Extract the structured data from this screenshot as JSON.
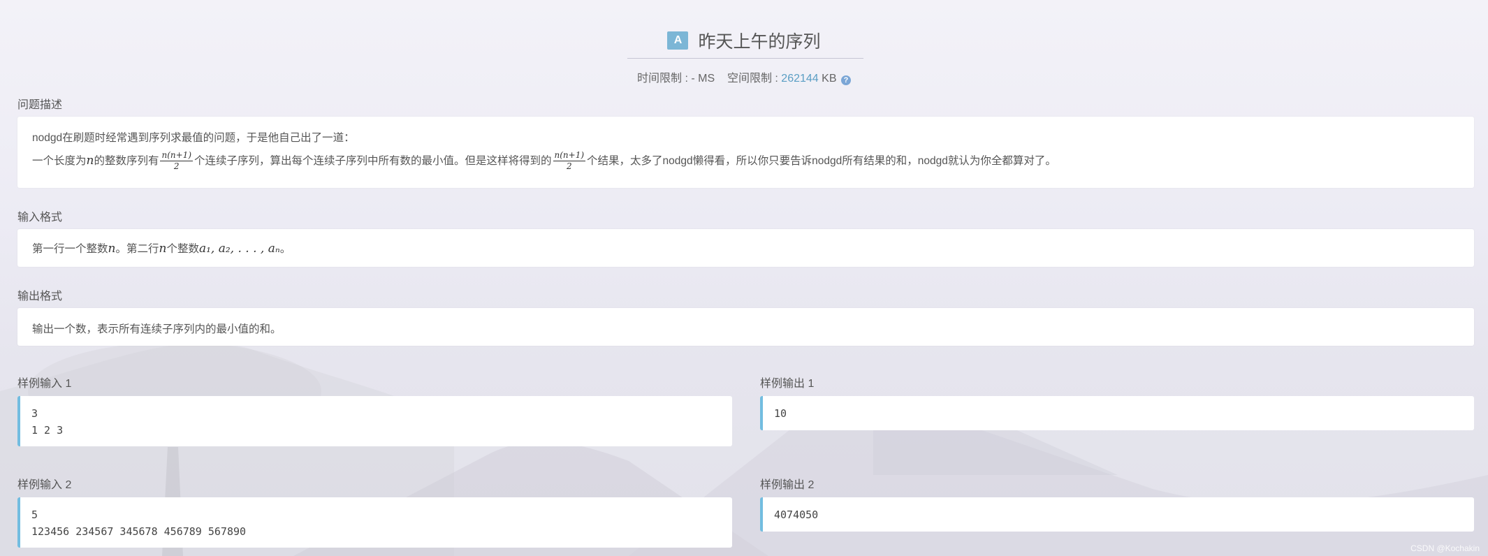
{
  "problem": {
    "badge": "A",
    "title": "昨天上午的序列",
    "time_limit_label": "时间限制 : ",
    "time_limit_value": "- MS",
    "memory_limit_label": "空间限制 : ",
    "memory_limit_value": "262144",
    "memory_unit": "KB"
  },
  "sections": {
    "description_label": "问题描述",
    "input_label": "输入格式",
    "output_label": "输出格式"
  },
  "description": {
    "line1": "nodgd在刷题时经常遇到序列求最值的问题，于是他自己出了一道：",
    "line2_a": "一个长度为",
    "line2_n": "n",
    "line2_b": "的整数序列有",
    "frac_num": "n(n+1)",
    "frac_den": "2",
    "line2_c": "个连续子序列，算出每个连续子序列中所有数的最小值。但是这样将得到的",
    "line2_d": "个结果，太多了nodgd懒得看，所以你只要告诉nodgd所有结果的和，nodgd就认为你全都算对了。"
  },
  "input_format": {
    "a": "第一行一个整数",
    "n1": "n",
    "b": "。第二行",
    "n2": "n",
    "c": "个整数",
    "seq": "a₁, a₂, . . . , aₙ",
    "d": "。"
  },
  "output_format": {
    "text": "输出一个数，表示所有连续子序列内的最小值的和。"
  },
  "samples": [
    {
      "input_label": "样例输入 1",
      "input": "3\n1 2 3",
      "output_label": "样例输出 1",
      "output": "10"
    },
    {
      "input_label": "样例输入 2",
      "input": "5\n123456 234567 345678 456789 567890",
      "output_label": "样例输出 2",
      "output": "4074050"
    }
  ],
  "watermark": "CSDN @Kochakin",
  "colors": {
    "accent": "#7cb6d6",
    "sample_border": "#72bde0",
    "link_blue": "#5a9ec4"
  },
  "icons": {
    "help": "help-circle-icon"
  }
}
